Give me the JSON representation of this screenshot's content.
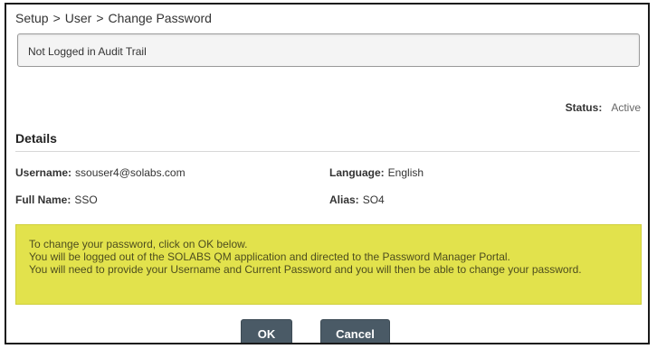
{
  "breadcrumb": {
    "items": [
      "Setup",
      "User",
      "Change Password"
    ],
    "separator": ">"
  },
  "audit_notice": "Not Logged in Audit Trail",
  "status": {
    "label": "Status:",
    "value": "Active"
  },
  "details": {
    "heading": "Details",
    "username_label": "Username:",
    "username_value": "ssouser4@solabs.com",
    "language_label": "Language:",
    "language_value": "English",
    "fullname_label": "Full Name:",
    "fullname_value": "SSO",
    "alias_label": "Alias:",
    "alias_value": "SO4"
  },
  "instructions": [
    "To change your password, click on OK below.",
    "You will be logged out of the SOLABS QM application and directed to the Password Manager Portal.",
    "You will need to provide your Username and Current Password and you will then be able to change your password."
  ],
  "buttons": {
    "ok_label": "OK",
    "cancel_label": "Cancel"
  },
  "colors": {
    "notice_background": "#e2e24c",
    "button_background": "#4a5a66",
    "frame_border": "#1a1a1a"
  }
}
